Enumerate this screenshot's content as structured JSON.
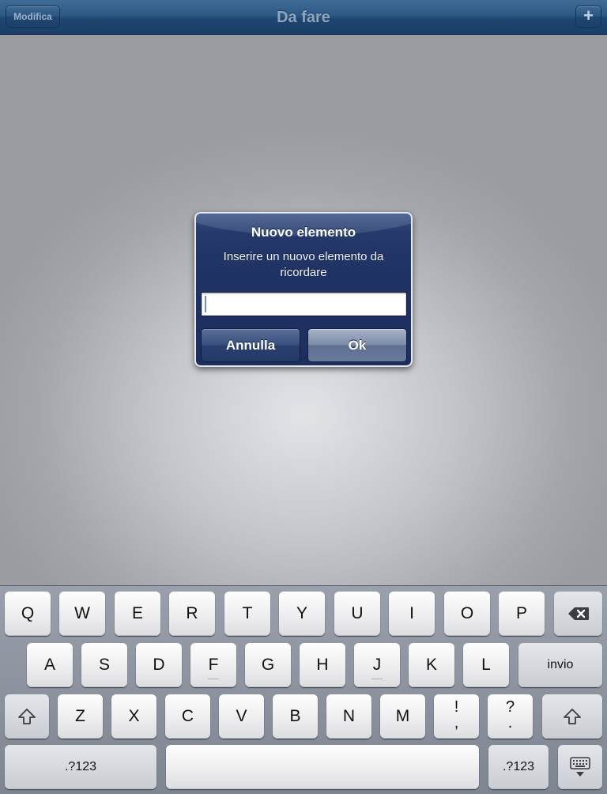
{
  "navbar": {
    "title": "Da fare",
    "edit_label": "Modifica",
    "add_label": "+"
  },
  "alert": {
    "title": "Nuovo elemento",
    "message": "Inserire un nuovo elemento da ricordare",
    "input_value": "",
    "cancel_label": "Annulla",
    "ok_label": "Ok"
  },
  "keyboard": {
    "row1": [
      "Q",
      "W",
      "E",
      "R",
      "T",
      "Y",
      "U",
      "I",
      "O",
      "P"
    ],
    "row2": [
      "A",
      "S",
      "D",
      "F",
      "G",
      "H",
      "J",
      "K",
      "L"
    ],
    "return_label": "invio",
    "row3": [
      "Z",
      "X",
      "C",
      "V",
      "B",
      "N",
      "M"
    ],
    "punct1": [
      "!",
      ","
    ],
    "punct2": [
      "?",
      "."
    ],
    "numbers_label": ".?123",
    "space_label": "",
    "icons": {
      "backspace": "backspace-icon",
      "shift": "shift-icon",
      "dismiss": "keyboard-dismiss-icon"
    }
  },
  "colors": {
    "navbar": "#1f4670",
    "alert_bg": "#1f3264",
    "keyboard_bg": "#8a909c"
  }
}
